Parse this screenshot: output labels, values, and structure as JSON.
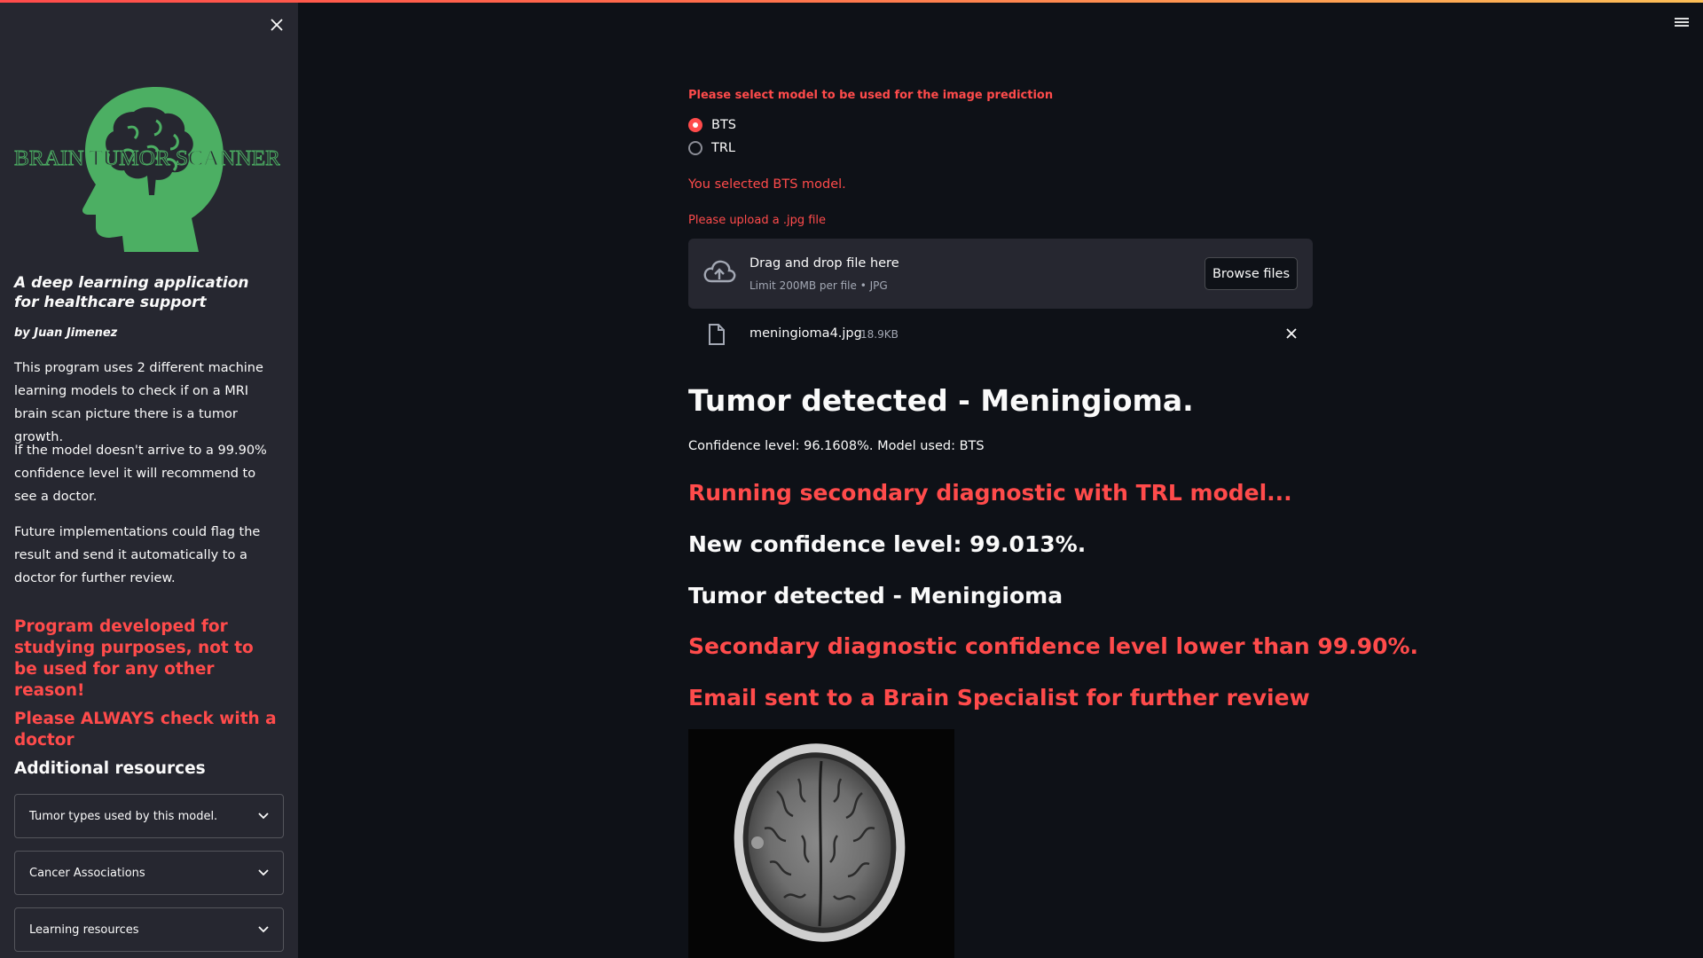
{
  "colors": {
    "accent": "#ff4b4b",
    "logo_green": "#4caf63",
    "background": "#0e1117",
    "sidebar": "#262730"
  },
  "sidebar": {
    "logo_text": "BRAIN TUMOR SCANNER",
    "tagline": "A deep learning application for healthcare support",
    "author": "by Juan Jimenez",
    "paragraphs": [
      "This program uses 2 different machine learning models to check if on a MRI brain scan picture there is a tumor growth.",
      "If the model doesn't arrive to a 99.90% confidence level it will recommend to see a doctor.",
      "Future implementations could flag the result and send it automatically to a doctor for further review."
    ],
    "warning_1": "Program developed for studying purposes, not to be used for any other reason!",
    "warning_2": "Please ALWAYS check with a doctor",
    "resources_title": "Additional resources",
    "expanders": [
      {
        "label": "Tumor types used by this model."
      },
      {
        "label": "Cancer Associations"
      },
      {
        "label": "Learning resources"
      }
    ]
  },
  "main": {
    "model_prompt": "Please select model to be used for the image prediction",
    "models": [
      {
        "label": "BTS",
        "selected": true
      },
      {
        "label": "TRL",
        "selected": false
      }
    ],
    "selected_msg": "You selected BTS model.",
    "upload_prompt": "Please upload a .jpg file",
    "uploader": {
      "title": "Drag and drop file here",
      "subtitle": "Limit 200MB per file • JPG",
      "button": "Browse files"
    },
    "file": {
      "name": "meningioma4.jpg",
      "size": "18.9KB"
    },
    "result_title": "Tumor detected - Meningioma.",
    "confidence_line": "Confidence level: 96.1608%. Model used: BTS",
    "secondary_running": "Running secondary diagnostic with TRL model...",
    "new_confidence": "New confidence level: 99.013%.",
    "secondary_result": "Tumor detected - Meningioma",
    "secondary_warning": "Secondary diagnostic confidence level lower than 99.90%.",
    "email_msg": "Email sent to a Brain Specialist for further review"
  }
}
